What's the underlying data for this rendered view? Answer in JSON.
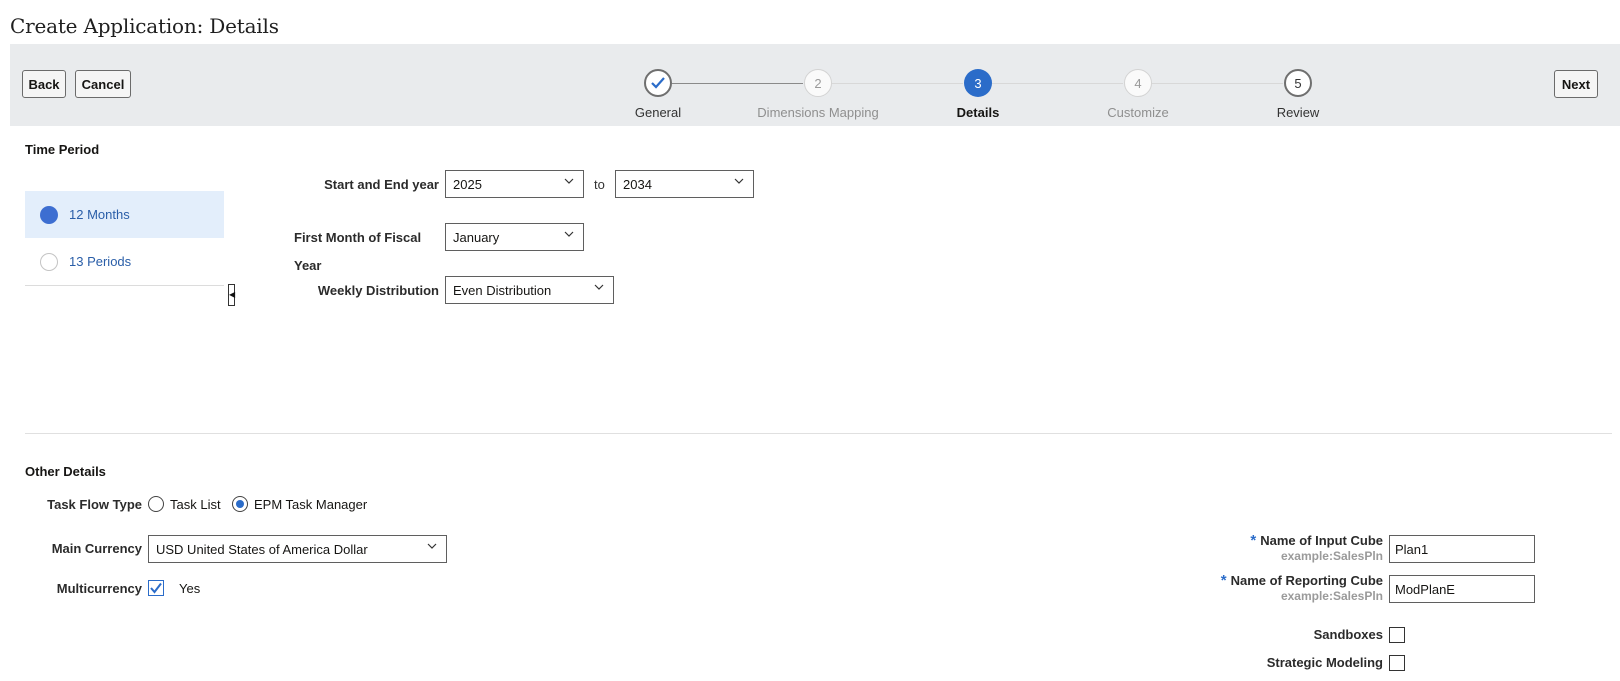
{
  "page": {
    "title": "Create Application: Details"
  },
  "toolbar": {
    "back_label": "Back",
    "cancel_label": "Cancel",
    "next_label": "Next"
  },
  "train": {
    "steps": [
      {
        "number": "",
        "label": "General",
        "state": "done"
      },
      {
        "number": "2",
        "label": "Dimensions Mapping",
        "state": "todo"
      },
      {
        "number": "3",
        "label": "Details",
        "state": "current"
      },
      {
        "number": "4",
        "label": "Customize",
        "state": "todo"
      },
      {
        "number": "5",
        "label": "Review",
        "state": "todo"
      }
    ]
  },
  "time_period": {
    "section_title": "Time Period",
    "options": [
      {
        "label": "12 Months",
        "selected": true
      },
      {
        "label": "13 Periods",
        "selected": false
      }
    ],
    "start_end_label": "Start and End year",
    "start_year": "2025",
    "to_label": "to",
    "end_year": "2034",
    "first_month_label_line1": "First Month of Fiscal",
    "first_month_label_line2": "Year",
    "first_month": "January",
    "weekly_dist_label": "Weekly Distribution",
    "weekly_dist": "Even Distribution"
  },
  "other_details": {
    "section_title": "Other Details",
    "task_flow_label": "Task Flow Type",
    "task_flow_options": [
      {
        "label": "Task List",
        "selected": false
      },
      {
        "label": "EPM Task Manager",
        "selected": true
      }
    ],
    "main_currency_label": "Main Currency",
    "main_currency": "USD United States of America Dollar",
    "multicurrency_label": "Multicurrency",
    "multicurrency_checked": true,
    "multicurrency_yes": "Yes",
    "input_cube_label": "Name of Input Cube",
    "input_cube_hint": "example:SalesPln",
    "input_cube_value": "Plan1",
    "reporting_cube_label": "Name of Reporting Cube",
    "reporting_cube_hint": "example:SalesPln",
    "reporting_cube_value": "ModPlanE",
    "sandboxes_label": "Sandboxes",
    "sandboxes_checked": false,
    "strategic_label": "Strategic Modeling",
    "strategic_checked": false
  },
  "icons": {
    "check": "check-icon",
    "chevron": "chevron-down-icon",
    "collapse": "collapse-left-icon",
    "required": "asterisk-icon"
  },
  "colors": {
    "accent": "#2b6cc9",
    "band": "#e9ebed",
    "selected_bg": "#e3eefb",
    "link": "#2a5ea8"
  }
}
